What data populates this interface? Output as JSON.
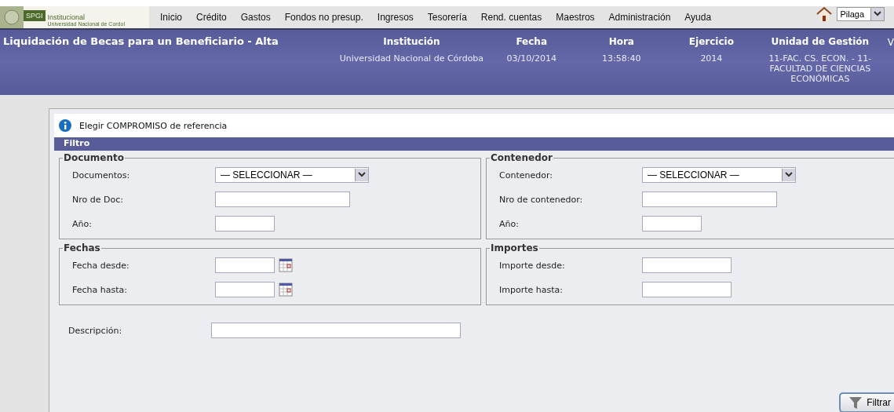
{
  "logo": {
    "badge": "SPGI",
    "line_1": "Institucional",
    "line_2": "Universidad Nacional de Cordol"
  },
  "menu": [
    "Inicio",
    "Crédito",
    "Gastos",
    "Fondos no presup.",
    "Ingresos",
    "Tesorería",
    "Rend. cuentas",
    "Maestros",
    "Administración",
    "Ayuda"
  ],
  "system_select": {
    "value": "Pilaga"
  },
  "header": {
    "title": "Liquidación de Becas para un Beneficiario - Alta",
    "columns": [
      {
        "label": "Institución",
        "value": "Universidad Nacional de Córdoba"
      },
      {
        "label": "Fecha",
        "value": "03/10/2014"
      },
      {
        "label": "Hora",
        "value": "13:58:40"
      },
      {
        "label": "Ejercicio",
        "value": "2014"
      },
      {
        "label": "Unidad de Gestión",
        "value": "11-FAC. CS. ECON. - 11-FACULTAD DE CIENCIAS ECONÓMICAS"
      }
    ],
    "trailing": "V"
  },
  "info": "Elegir COMPROMISO de referencia",
  "filter_title": "Filtro",
  "groups": [
    {
      "legend": "Documento",
      "fields": [
        {
          "label": "Documentos:",
          "kind": "select",
          "value": "— SELECCIONAR —"
        },
        {
          "label": "Nro de Doc:",
          "kind": "long"
        },
        {
          "label": "Año:",
          "kind": "short"
        }
      ]
    },
    {
      "legend": "Contenedor",
      "fields": [
        {
          "label": "Contenedor:",
          "kind": "select",
          "value": "— SELECCIONAR —"
        },
        {
          "label": "Nro de contenedor:",
          "kind": "long"
        },
        {
          "label": "Año:",
          "kind": "short"
        }
      ]
    },
    {
      "legend": "Fechas",
      "fields": [
        {
          "label": "Fecha desde:",
          "kind": "date"
        },
        {
          "label": "Fecha hasta:",
          "kind": "date"
        }
      ]
    },
    {
      "legend": "Importes",
      "fields": [
        {
          "label": "Importe desde:",
          "kind": "medium"
        },
        {
          "label": "Importe hasta:",
          "kind": "medium"
        }
      ]
    }
  ],
  "description": {
    "label": "Descripción:"
  },
  "filter_button": "Filtrar"
}
